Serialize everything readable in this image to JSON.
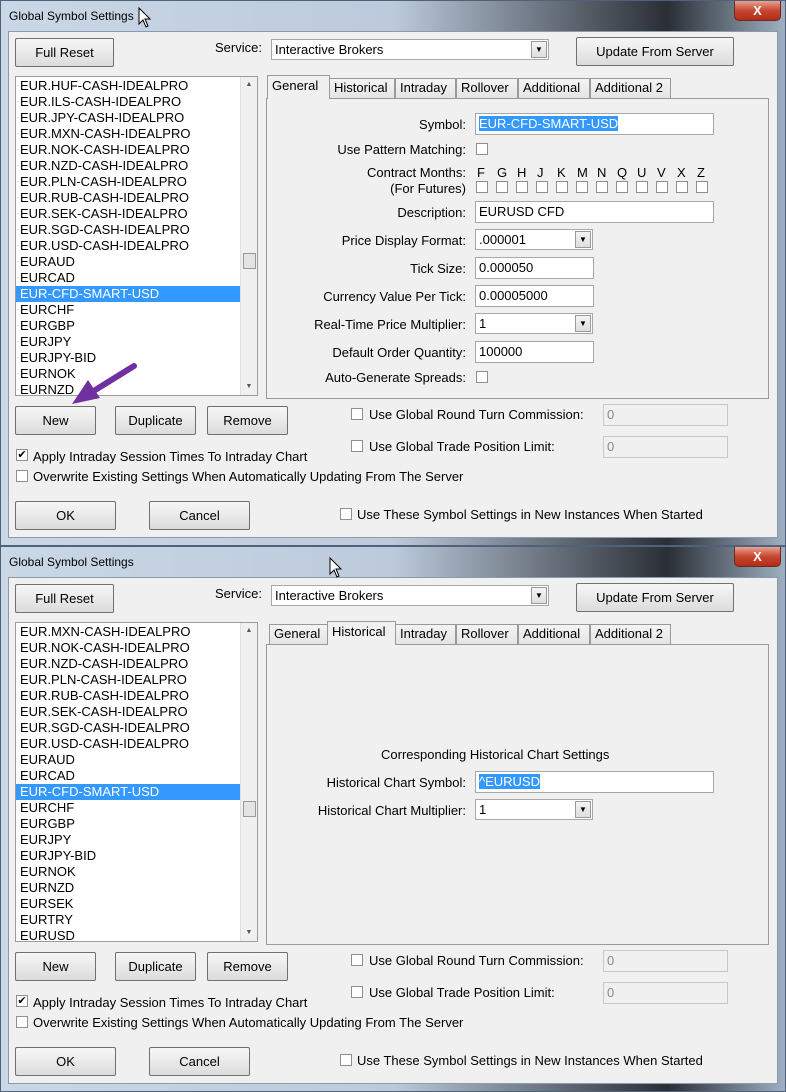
{
  "dialogs": [
    {
      "title": "Global Symbol Settings",
      "close_label": "X",
      "full_reset": "Full Reset",
      "service_label": "Service:",
      "service_value": "Interactive Brokers",
      "update_button": "Update From Server",
      "symbols": [
        "EUR.HUF-CASH-IDEALPRO",
        "EUR.ILS-CASH-IDEALPRO",
        "EUR.JPY-CASH-IDEALPRO",
        "EUR.MXN-CASH-IDEALPRO",
        "EUR.NOK-CASH-IDEALPRO",
        "EUR.NZD-CASH-IDEALPRO",
        "EUR.PLN-CASH-IDEALPRO",
        "EUR.RUB-CASH-IDEALPRO",
        "EUR.SEK-CASH-IDEALPRO",
        "EUR.SGD-CASH-IDEALPRO",
        "EUR.USD-CASH-IDEALPRO",
        "EURAUD",
        "EURCAD",
        "EUR-CFD-SMART-USD",
        "EURCHF",
        "EURGBP",
        "EURJPY",
        "EURJPY-BID",
        "EURNOK",
        "EURNZD"
      ],
      "selected_symbol": "EUR-CFD-SMART-USD",
      "active_tab": "General",
      "tabs": [
        "General",
        "Historical",
        "Intraday",
        "Rollover",
        "Additional",
        "Additional 2"
      ],
      "general": {
        "symbol_label": "Symbol:",
        "symbol_value": "EUR-CFD-SMART-USD",
        "pattern_label": "Use Pattern Matching:",
        "months_label": "Contract Months:",
        "futures_label": "(For Futures)",
        "months": [
          "F",
          "G",
          "H",
          "J",
          "K",
          "M",
          "N",
          "Q",
          "U",
          "V",
          "X",
          "Z"
        ],
        "description_label": "Description:",
        "description_value": "EURUSD CFD",
        "price_format_label": "Price Display Format:",
        "price_format_value": ".000001",
        "tick_size_label": "Tick Size:",
        "tick_size_value": "0.000050",
        "currency_label": "Currency Value Per Tick:",
        "currency_value": "0.00005000",
        "multiplier_label": "Real-Time Price Multiplier:",
        "multiplier_value": "1",
        "order_qty_label": "Default Order Quantity:",
        "order_qty_value": "100000",
        "spreads_label": "Auto-Generate Spreads:"
      },
      "new_button": "New",
      "duplicate_button": "Duplicate",
      "remove_button": "Remove",
      "round_turn_label": "Use Global Round Turn Commission:",
      "round_turn_value": "0",
      "trade_limit_label": "Use Global Trade Position Limit:",
      "trade_limit_value": "0",
      "apply_intraday_label": "Apply Intraday Session Times To Intraday Chart",
      "apply_intraday_checked": true,
      "overwrite_label": "Overwrite Existing Settings When Automatically Updating From The Server",
      "overwrite_checked": false,
      "ok_button": "OK",
      "cancel_button": "Cancel",
      "new_instances_label": "Use These Symbol Settings in New Instances When Started"
    },
    {
      "title": "Global Symbol Settings",
      "close_label": "X",
      "full_reset": "Full Reset",
      "service_label": "Service:",
      "service_value": "Interactive Brokers",
      "update_button": "Update From Server",
      "symbols": [
        "EUR.MXN-CASH-IDEALPRO",
        "EUR.NOK-CASH-IDEALPRO",
        "EUR.NZD-CASH-IDEALPRO",
        "EUR.PLN-CASH-IDEALPRO",
        "EUR.RUB-CASH-IDEALPRO",
        "EUR.SEK-CASH-IDEALPRO",
        "EUR.SGD-CASH-IDEALPRO",
        "EUR.USD-CASH-IDEALPRO",
        "EURAUD",
        "EURCAD",
        "EUR-CFD-SMART-USD",
        "EURCHF",
        "EURGBP",
        "EURJPY",
        "EURJPY-BID",
        "EURNOK",
        "EURNZD",
        "EURSEK",
        "EURTRY",
        "EURUSD"
      ],
      "selected_symbol": "EUR-CFD-SMART-USD",
      "active_tab": "Historical",
      "tabs": [
        "General",
        "Historical",
        "Intraday",
        "Rollover",
        "Additional",
        "Additional 2"
      ],
      "historical": {
        "heading": "Corresponding Historical Chart Settings",
        "symbol_label": "Historical Chart Symbol:",
        "symbol_value": "^EURUSD",
        "multiplier_label": "Historical Chart Multiplier:",
        "multiplier_value": "1"
      },
      "new_button": "New",
      "duplicate_button": "Duplicate",
      "remove_button": "Remove",
      "round_turn_label": "Use Global Round Turn Commission:",
      "round_turn_value": "0",
      "trade_limit_label": "Use Global Trade Position Limit:",
      "trade_limit_value": "0",
      "apply_intraday_label": "Apply Intraday Session Times To Intraday Chart",
      "apply_intraday_checked": true,
      "overwrite_label": "Overwrite Existing Settings When Automatically Updating From The Server",
      "overwrite_checked": false,
      "ok_button": "OK",
      "cancel_button": "Cancel",
      "new_instances_label": "Use These Symbol Settings in New Instances When Started"
    }
  ],
  "colors": {
    "selection": "#3399ff",
    "annotation_arrow": "#7030a0"
  },
  "icons": {
    "close": "close-icon",
    "dropdown": "chevron-down-icon",
    "annotation": "arrow-annotation-icon",
    "cursor": "mouse-pointer-icon"
  }
}
